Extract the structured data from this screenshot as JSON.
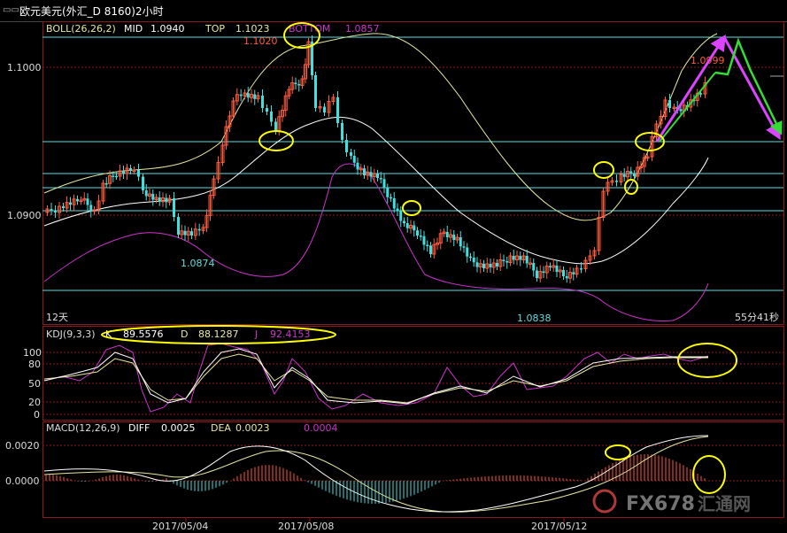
{
  "window": {
    "title": "欧元美元(外汇_D 8160)2小时",
    "icon": "window-menu-icon"
  },
  "boll": {
    "name": "BOLL(26,26,2)",
    "mid_label": "MID",
    "mid_value": "1.0940",
    "top_label": "TOP",
    "top_value": "1.1023",
    "bottom_label": "BOTTOM",
    "bottom_value": "1.0857"
  },
  "price_axis": {
    "ticks": [
      "1.1000",
      "1.0900"
    ]
  },
  "price_annotations": {
    "high": "1.1020",
    "low1": "1.0874",
    "low2": "1.0838",
    "current": "1.0999"
  },
  "period_label": "12天",
  "countdown": "55分41秒",
  "kdj": {
    "name": "KDJ(9,3,3)",
    "k_label": "K",
    "k_value": "89.5576",
    "d_label": "D",
    "d_value": "88.1287",
    "j_label": "J",
    "j_value": "92.4153",
    "ticks": [
      "100",
      "80",
      "50",
      "20",
      "0"
    ]
  },
  "macd": {
    "name": "MACD(12,26,9)",
    "diff_label": "DIFF",
    "diff_value": "0.0025",
    "dea_label": "DEA",
    "dea_value": "0.0023",
    "macd_value": "0.0004",
    "ticks": [
      "0.0020",
      "0.0000"
    ]
  },
  "x_axis": {
    "dates": [
      "2017/05/04",
      "2017/05/08",
      "2017/05/12"
    ]
  },
  "watermark": {
    "text": "FX678",
    "cn": "汇通网"
  },
  "colors": {
    "up": "#ff5a3c",
    "down": "#3ee0e0",
    "upper_band": "#e8e8a0",
    "mid_band": "#ffffff",
    "lower_band": "#cc33cc",
    "horizontal_line": "#5fdede",
    "highlight": "#ffff00",
    "arrow_up": "#dd44ff",
    "arrow_green": "#33dd33"
  }
}
